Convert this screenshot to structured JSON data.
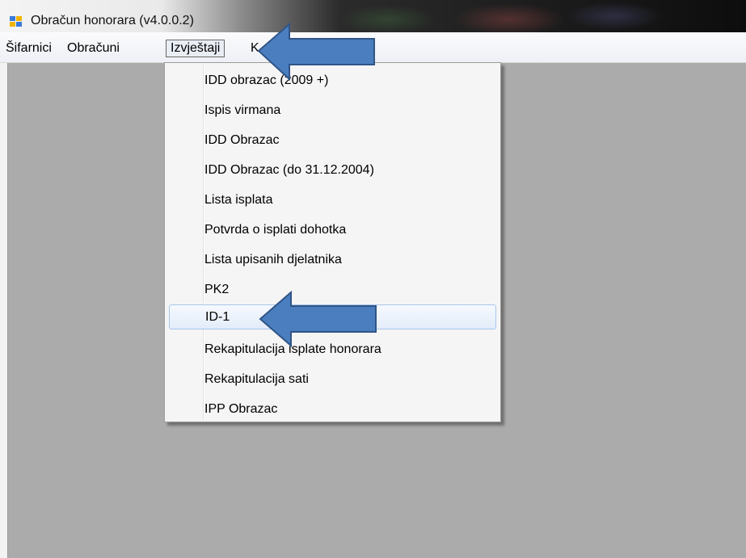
{
  "window": {
    "title": "Obračun honorara (v4.0.0.2)"
  },
  "menubar": {
    "items": [
      {
        "label": "Šifarnici"
      },
      {
        "label": "Obračuni"
      },
      {
        "label": "Izvještaji"
      },
      {
        "label": "K"
      }
    ]
  },
  "dropdown": {
    "items": [
      {
        "label": "IDD obrazac (2009 +)"
      },
      {
        "label": "Ispis virmana"
      },
      {
        "label": "IDD Obrazac"
      },
      {
        "label": "IDD Obrazac (do 31.12.2004)"
      },
      {
        "label": "Lista isplata"
      },
      {
        "label": "Potvrda o isplati dohotka"
      },
      {
        "label": "Lista upisanih djelatnika"
      },
      {
        "label": "PK2"
      },
      {
        "label": "ID-1"
      },
      {
        "label": "Rekapitulacija isplate honorara"
      },
      {
        "label": "Rekapitulacija sati"
      },
      {
        "label": "IPP Obrazac"
      }
    ],
    "highlighted_label": "ID-1"
  },
  "annotations": {
    "arrow_color": "#4a7ebf",
    "arrow_outline": "#2f5587",
    "arrow_icons": [
      "left-arrow-icon",
      "left-arrow-icon"
    ]
  }
}
